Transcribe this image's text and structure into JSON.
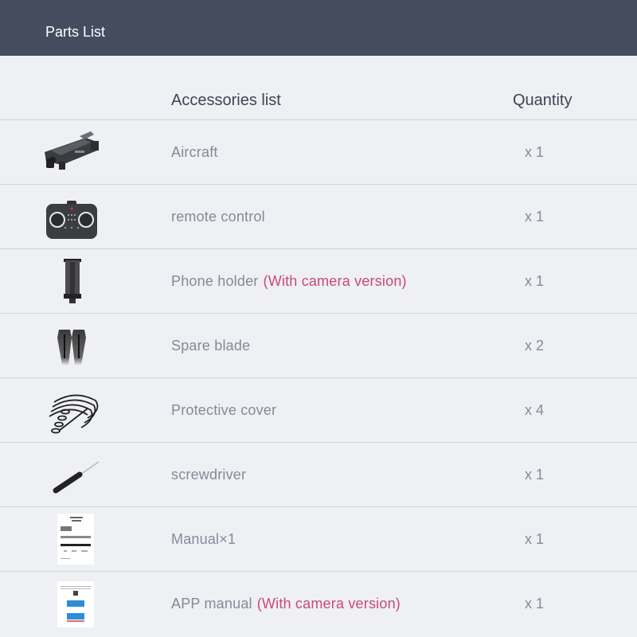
{
  "header": {
    "title": "Parts List"
  },
  "columns": {
    "accessories": "Accessories list",
    "quantity": "Quantity"
  },
  "colors": {
    "header_bg": "#454c5e",
    "page_bg": "#eef0f4",
    "note": "#c94a6e",
    "text_muted": "#858a97"
  },
  "items": [
    {
      "icon": "drone-icon",
      "label": "Aircraft",
      "note": "",
      "qty": "x 1"
    },
    {
      "icon": "remote-control-icon",
      "label": "remote control",
      "note": "",
      "qty": "x 1"
    },
    {
      "icon": "phone-holder-icon",
      "label": "Phone holder",
      "note": "(With camera version)",
      "qty": "x 1"
    },
    {
      "icon": "propeller-blade-icon",
      "label": "Spare blade",
      "note": "",
      "qty": "x 2"
    },
    {
      "icon": "propeller-guard-icon",
      "label": "Protective cover",
      "note": "",
      "qty": "x 4"
    },
    {
      "icon": "screwdriver-icon",
      "label": "screwdriver",
      "note": "",
      "qty": "x 1"
    },
    {
      "icon": "manual-icon",
      "label": "Manual×1",
      "note": "",
      "qty": "x 1"
    },
    {
      "icon": "app-manual-icon",
      "label": "APP manual",
      "note": "(With camera version)",
      "qty": "x 1"
    }
  ]
}
